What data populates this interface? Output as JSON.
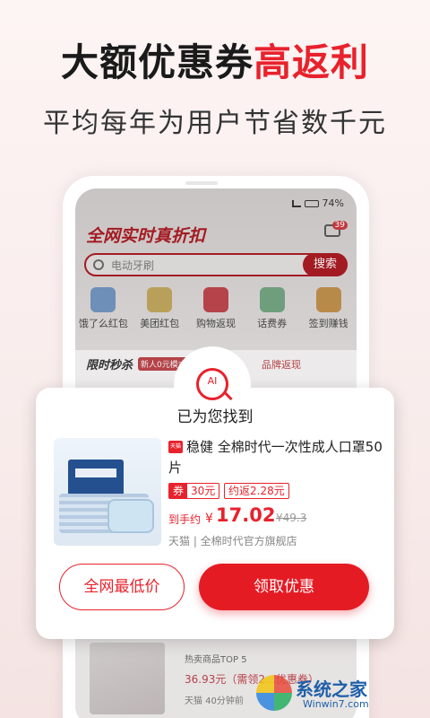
{
  "headline": {
    "part1": "大额优惠券",
    "part2": "高返利"
  },
  "subheadline": "平均每年为用户节省数千元",
  "phone": {
    "status_battery": "74%",
    "app_title": "全网实时真折扣",
    "message_badge": "39",
    "search": {
      "placeholder": "电动牙刷",
      "button": "搜索"
    },
    "categories": [
      {
        "label": "饿了么红包",
        "color": "#6d8fb8"
      },
      {
        "label": "美团红包",
        "color": "#b9a05a"
      },
      {
        "label": "购物返现",
        "color": "#b54349"
      },
      {
        "label": "话费券",
        "color": "#6f9e7c"
      },
      {
        "label": "签到赚钱",
        "color": "#b88a4a"
      }
    ],
    "promo_title": "限时秒杀",
    "promo_tag": "新人0元模式",
    "promo_right": "品牌返现",
    "bottom": {
      "title": "热卖商品TOP 5",
      "price_line": "36.93元（需领2…优惠券）",
      "meta": "天猫 40分钟前"
    }
  },
  "popup": {
    "badge_text": "AI",
    "found_text": "已为您找到",
    "platform_icon": "天猫",
    "product_title": "稳健 全棉时代一次性成人口罩50片",
    "coupon_label": "券",
    "coupon_value": "30元",
    "rebate": "约返2.28元",
    "price_label": "到手约",
    "currency": "¥",
    "price": "17.02",
    "old_price": "¥49.3",
    "shop": "天猫 | 全棉时代官方旗舰店",
    "btn_lowest": "全网最低价",
    "btn_claim": "领取优惠"
  },
  "watermark": {
    "text": "系统之家",
    "url": "Winwin7.com"
  },
  "colors": {
    "brand_red": "#e8222c",
    "button_red": "#e51b24"
  }
}
